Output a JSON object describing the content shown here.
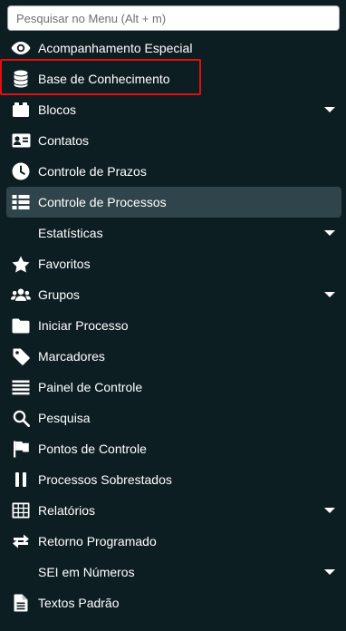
{
  "search": {
    "placeholder": "Pesquisar no Menu (Alt + m)",
    "value": ""
  },
  "menu": {
    "items": [
      {
        "label": "Acompanhamento Especial",
        "icon": "eye-icon"
      },
      {
        "label": "Base de Conhecimento",
        "icon": "database-icon",
        "highlighted": true
      },
      {
        "label": "Blocos",
        "icon": "blocks-icon",
        "expandable": true
      },
      {
        "label": "Contatos",
        "icon": "contact-card-icon"
      },
      {
        "label": "Controle de Prazos",
        "icon": "clock-icon"
      },
      {
        "label": "Controle de Processos",
        "icon": "list-icon",
        "active": true
      },
      {
        "label": "Estatísticas",
        "expandable": true
      },
      {
        "label": "Favoritos",
        "icon": "star-icon"
      },
      {
        "label": "Grupos",
        "icon": "users-icon",
        "expandable": true
      },
      {
        "label": "Iniciar Processo",
        "icon": "folder-icon"
      },
      {
        "label": "Marcadores",
        "icon": "tag-icon"
      },
      {
        "label": "Painel de Controle",
        "icon": "bars-icon"
      },
      {
        "label": "Pesquisa",
        "icon": "search-icon"
      },
      {
        "label": "Pontos de Controle",
        "icon": "flag-icon"
      },
      {
        "label": "Processos Sobrestados",
        "icon": "pause-icon"
      },
      {
        "label": "Relatórios",
        "icon": "table-icon",
        "expandable": true
      },
      {
        "label": "Retorno Programado",
        "icon": "exchange-icon"
      },
      {
        "label": "SEI em Números",
        "expandable": true
      },
      {
        "label": "Textos Padrão",
        "icon": "file-text-icon"
      }
    ]
  },
  "colors": {
    "background": "#0d1e23",
    "active_background": "#30454b",
    "highlight_border": "#e01010",
    "text": "#ffffff"
  }
}
